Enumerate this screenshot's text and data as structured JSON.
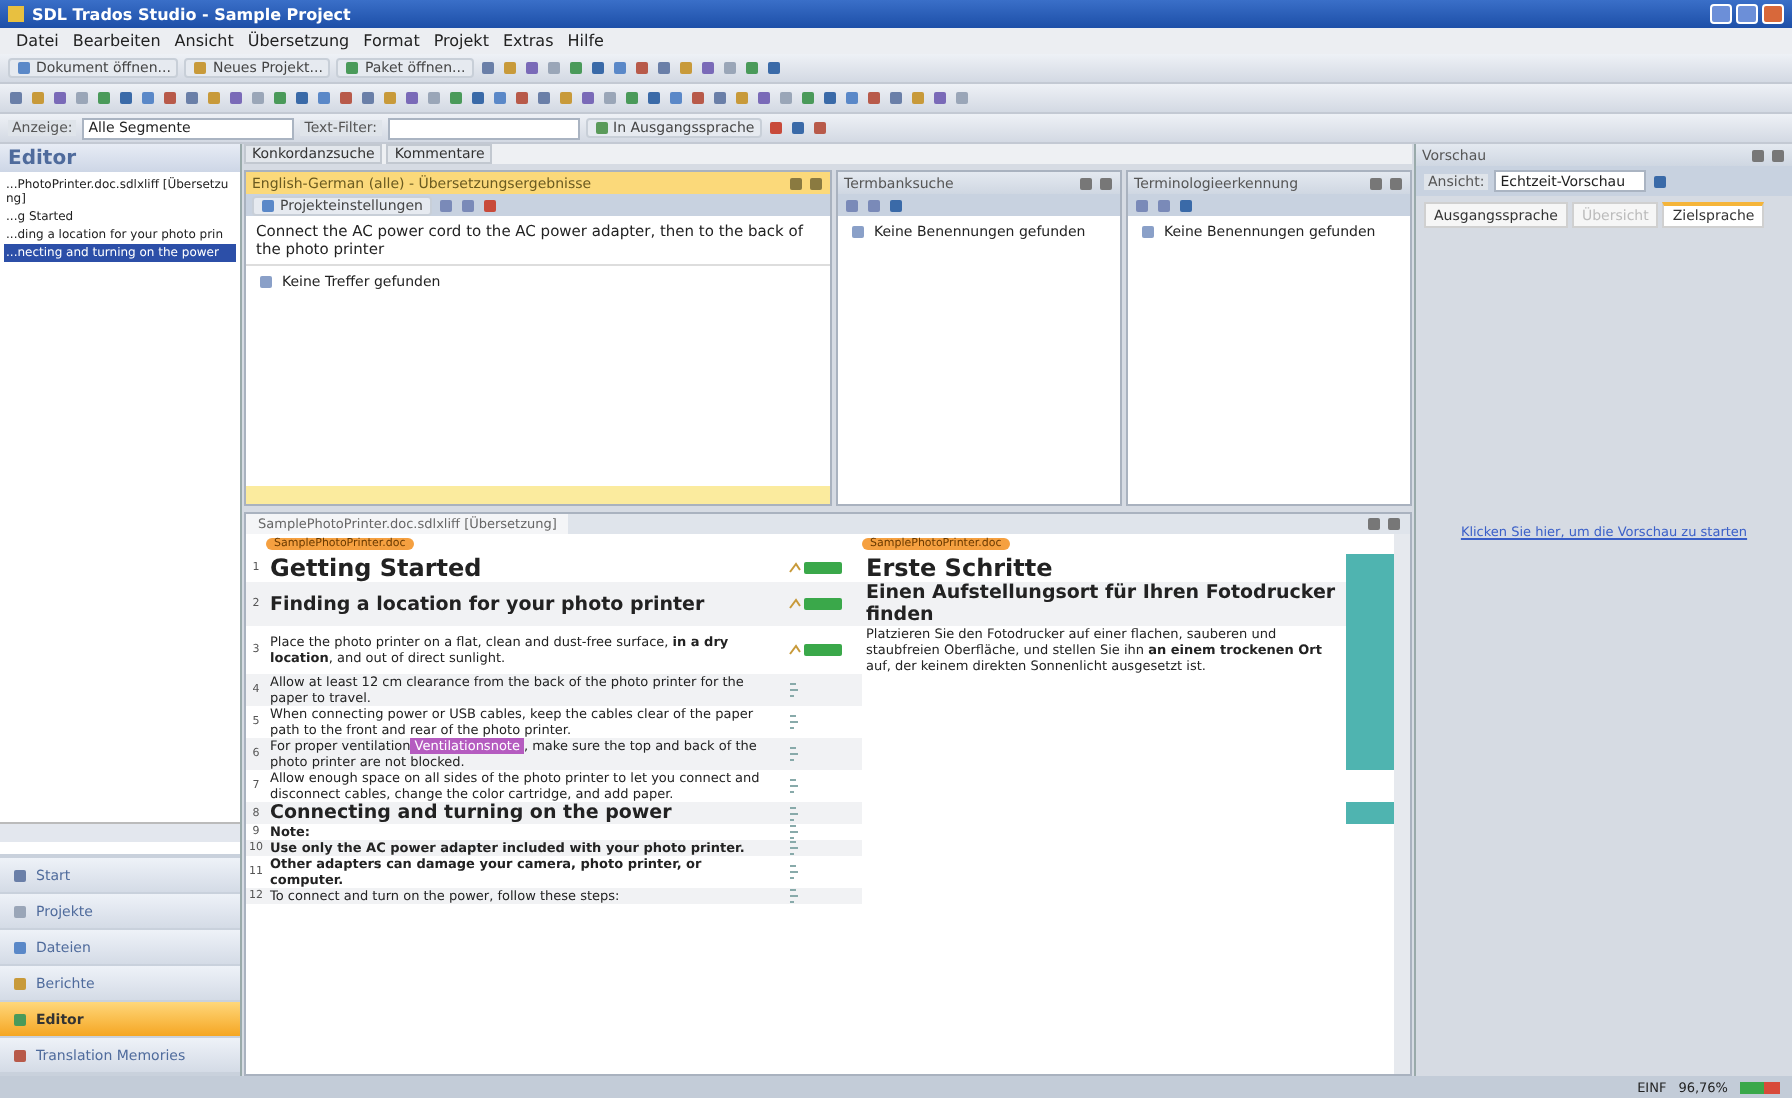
{
  "window": {
    "title": "SDL Trados Studio - Sample Project"
  },
  "menu": [
    "Datei",
    "Bearbeiten",
    "Ansicht",
    "Übersetzung",
    "Format",
    "Projekt",
    "Extras",
    "Hilfe"
  ],
  "toolbar": {
    "buttons": [
      "Dokument öffnen...",
      "Neues Projekt...",
      "Paket öffnen..."
    ]
  },
  "filter_bar": {
    "display_label": "Anzeige:",
    "display_value": "Alle Segmente",
    "text_filter_label": "Text-Filter:",
    "source_toggle": "In Ausgangssprache"
  },
  "sidebar": {
    "title": "Editor",
    "items": [
      {
        "label": "...PhotoPrinter.doc.sdlxliff [Übersetzung]",
        "selected": false
      },
      {
        "label": "...g Started",
        "selected": false
      },
      {
        "label": "...ding a location for your photo prin",
        "selected": false
      },
      {
        "label": "...necting and turning on the power",
        "selected": true
      }
    ],
    "nav": [
      {
        "label": "Start",
        "selected": false
      },
      {
        "label": "Projekte",
        "selected": false
      },
      {
        "label": "Dateien",
        "selected": false
      },
      {
        "label": "Berichte",
        "selected": false
      },
      {
        "label": "Editor",
        "selected": true
      },
      {
        "label": "Translation Memories",
        "selected": false
      }
    ]
  },
  "top_tabs": [
    {
      "label": "Konkordanzsuche",
      "selected": false
    },
    {
      "label": "Kommentare",
      "selected": false
    }
  ],
  "tm_panel": {
    "title": "English-German (alle) - Übersetzungsergebnisse",
    "toolbar_label": "Projekteinstellungen",
    "source": "Connect the AC power cord to the AC power adapter, then to the back of the photo printer",
    "result": "Keine Treffer gefunden"
  },
  "term_panels": [
    {
      "title": "Termbanksuche",
      "result": "Keine Benennungen gefunden"
    },
    {
      "title": "Terminologieerkennung",
      "result": "Keine Benennungen gefunden"
    }
  ],
  "preview": {
    "title": "Vorschau",
    "view_label": "Ansicht:",
    "view_value": "Echtzeit-Vorschau",
    "tabs": [
      {
        "label": "Ausgangssprache",
        "selected": false,
        "disabled": false
      },
      {
        "label": "Übersicht",
        "selected": false,
        "disabled": true
      },
      {
        "label": "Zielsprache",
        "selected": true,
        "disabled": false
      }
    ],
    "link": "Klicken Sie hier, um die Vorschau zu starten"
  },
  "editor": {
    "tab": "SamplePhotoPrinter.doc.sdlxliff [Übersetzung]",
    "file_tag_source": "SamplePhotoPrinter.doc",
    "file_tag_target": "SamplePhotoPrinter.doc",
    "rows": [
      {
        "number": "1",
        "kind": "heading1",
        "source": "Getting Started",
        "confirmed": true,
        "target": "Erste Schritte",
        "context_marked": true
      },
      {
        "number": "2",
        "kind": "heading2",
        "source": "Finding a location for your photo printer",
        "confirmed": true,
        "target": "Einen Aufstellungsort für Ihren Fotodrucker finden",
        "context_marked": true
      },
      {
        "number": "3",
        "kind": "body",
        "source": "Place the photo printer on a flat, clean and dust-free surface, **in a dry location**, and out of direct sunlight.",
        "confirmed": true,
        "target": "Platzieren Sie den Fotodrucker auf einer flachen, sauberen und staubfreien Oberfläche, und stellen Sie ihn **an einem trockenen Ort** auf, der keinem direkten Sonnenlicht ausgesetzt ist.",
        "context_marked": true
      },
      {
        "number": "4",
        "kind": "body",
        "source": "Allow at least 12 cm clearance from the back of the photo printer for the paper to travel.",
        "confirmed": false,
        "context_marked": true
      },
      {
        "number": "5",
        "kind": "body",
        "source": "When connecting power or USB cables, keep the cables clear of the paper path to the front and rear of the photo printer.",
        "confirmed": false,
        "context_marked": true
      },
      {
        "number": "6",
        "kind": "body",
        "source": "For proper ventilation",
        "tag": "Ventilationsnote",
        "source_end": ", make sure the top and back of the photo printer are not blocked.",
        "confirmed": false,
        "context_marked": true
      },
      {
        "number": "7",
        "kind": "body",
        "source": "Allow enough space on all sides of the photo printer to let you connect and disconnect cables, change the color cartridge, and add paper.",
        "confirmed": false,
        "context_marked": false
      },
      {
        "number": "8",
        "kind": "heading2",
        "source": "Connecting and turning on the power",
        "confirmed": false,
        "context_marked": true
      },
      {
        "number": "9",
        "kind": "bold",
        "source": "Note:",
        "confirmed": false,
        "context_marked": false
      },
      {
        "number": "10",
        "kind": "bold",
        "source": "Use only the AC power adapter included with your photo printer.",
        "confirmed": false,
        "context_marked": false
      },
      {
        "number": "11",
        "kind": "bold",
        "source": "Other adapters can damage your camera, photo printer, or computer.",
        "confirmed": false,
        "context_marked": false
      },
      {
        "number": "12",
        "kind": "body",
        "source": "To connect and turn on the power, follow these steps:",
        "confirmed": false,
        "context_marked": false
      }
    ]
  },
  "status_bar": {
    "mode": "EINF",
    "progress": "96,76%"
  }
}
